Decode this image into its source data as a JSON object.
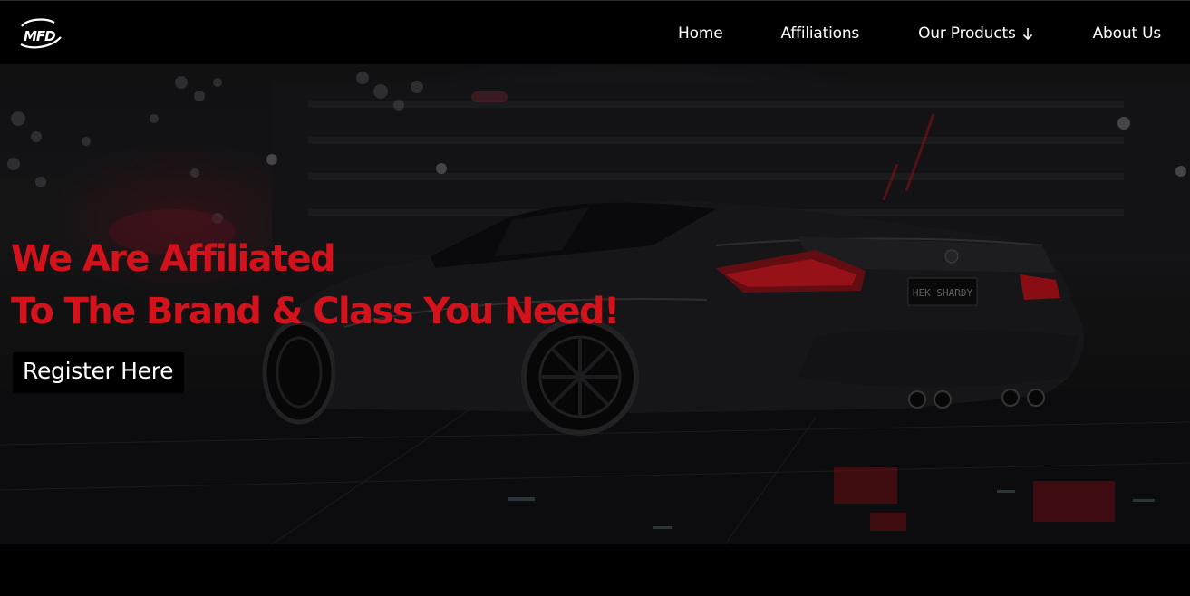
{
  "brand": {
    "logo_text": "MFD"
  },
  "nav": {
    "items": [
      {
        "label": "Home"
      },
      {
        "label": "Affiliations"
      },
      {
        "label": "Our Products"
      },
      {
        "label": "About Us"
      }
    ],
    "products_icon": "arrow-down-icon"
  },
  "hero": {
    "headline_line1": "We Are Affiliated",
    "headline_line2": "To The Brand & Class You Need!",
    "cta_label": "Register Here",
    "background_description_icon": "sports-car-night-image",
    "plate_text": "HEK SHARDY"
  },
  "colors": {
    "accent": "#d4121c",
    "background": "#000000",
    "nav_text": "#ffffff"
  }
}
